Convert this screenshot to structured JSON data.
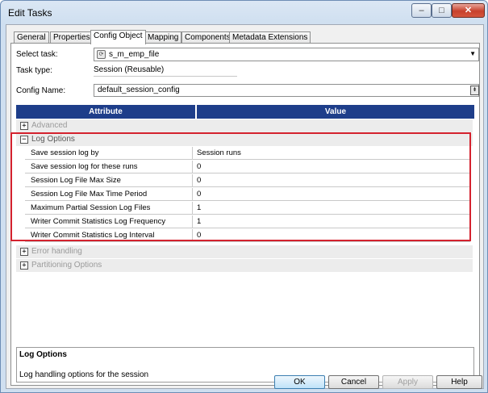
{
  "window": {
    "title": "Edit Tasks",
    "controls": {
      "minimize": "–",
      "maximize": "□",
      "close": "✕"
    }
  },
  "tabs": [
    {
      "label": "General"
    },
    {
      "label": "Properties"
    },
    {
      "label": "Config Object",
      "active": true
    },
    {
      "label": "Mapping"
    },
    {
      "label": "Components"
    },
    {
      "label": "Metadata Extensions"
    }
  ],
  "form": {
    "select_task_label": "Select task:",
    "select_task_value": "s_m_emp_file",
    "task_type_label": "Task type:",
    "task_type_value": "Session (Reusable)",
    "config_name_label": "Config Name:",
    "config_name_value": "default_session_config"
  },
  "grid": {
    "columns": [
      "Attribute",
      "Value"
    ],
    "groups": [
      {
        "label": "Advanced",
        "expanded": false
      },
      {
        "label": "Log Options",
        "expanded": true
      },
      {
        "label": "Error handling",
        "expanded": false
      },
      {
        "label": "Partitioning Options",
        "expanded": false
      }
    ],
    "log_options_rows": [
      {
        "attribute": "Save session log by",
        "value": "Session runs"
      },
      {
        "attribute": "Save session log for these runs",
        "value": "0"
      },
      {
        "attribute": "Session Log File Max Size",
        "value": "0"
      },
      {
        "attribute": "Session Log File Max Time Period",
        "value": "0"
      },
      {
        "attribute": "Maximum Partial Session Log Files",
        "value": "1"
      },
      {
        "attribute": "Writer Commit Statistics Log Frequency",
        "value": "1"
      },
      {
        "attribute": "Writer Commit Statistics Log Interval",
        "value": "0"
      }
    ]
  },
  "description": {
    "title": "Log Options",
    "text": "Log handling options for the session"
  },
  "buttons": {
    "ok": "OK",
    "cancel": "Cancel",
    "apply": "Apply",
    "help": "Help"
  },
  "colors": {
    "header_blue": "#1e3e8a",
    "highlight_red": "#d4222e"
  }
}
